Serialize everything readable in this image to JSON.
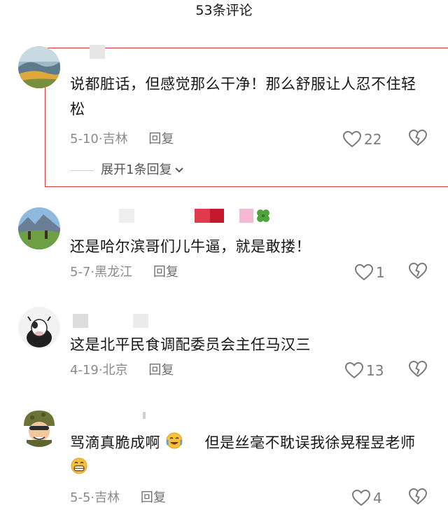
{
  "header": {
    "title": "53条评论"
  },
  "comments": [
    {
      "text": "说都脏话，但感觉那么干净！那么舒服让人忍不住轻松",
      "date": "5-10",
      "location": "吉林",
      "reply": "回复",
      "likes": "22",
      "expand": "展开1条回复"
    },
    {
      "text": "还是哈尔滨哥们儿牛逼，就是敢搂！",
      "date": "5-7",
      "location": "黑龙江",
      "reply": "回复",
      "likes": "1"
    },
    {
      "text": "这是北平民食调配委员会主任马汉三",
      "date": "4-19",
      "location": "北京",
      "reply": "回复",
      "likes": "13"
    },
    {
      "text_part1": "骂滴真脆成啊",
      "text_part2": "但是丝毫不耽误我徐晃程昱老师",
      "date": "5-5",
      "location": "吉林",
      "reply": "回复",
      "likes": "4"
    }
  ],
  "colors": {
    "highlight_border": "#d23b3b",
    "meta_gray": "#8a8a8a"
  }
}
